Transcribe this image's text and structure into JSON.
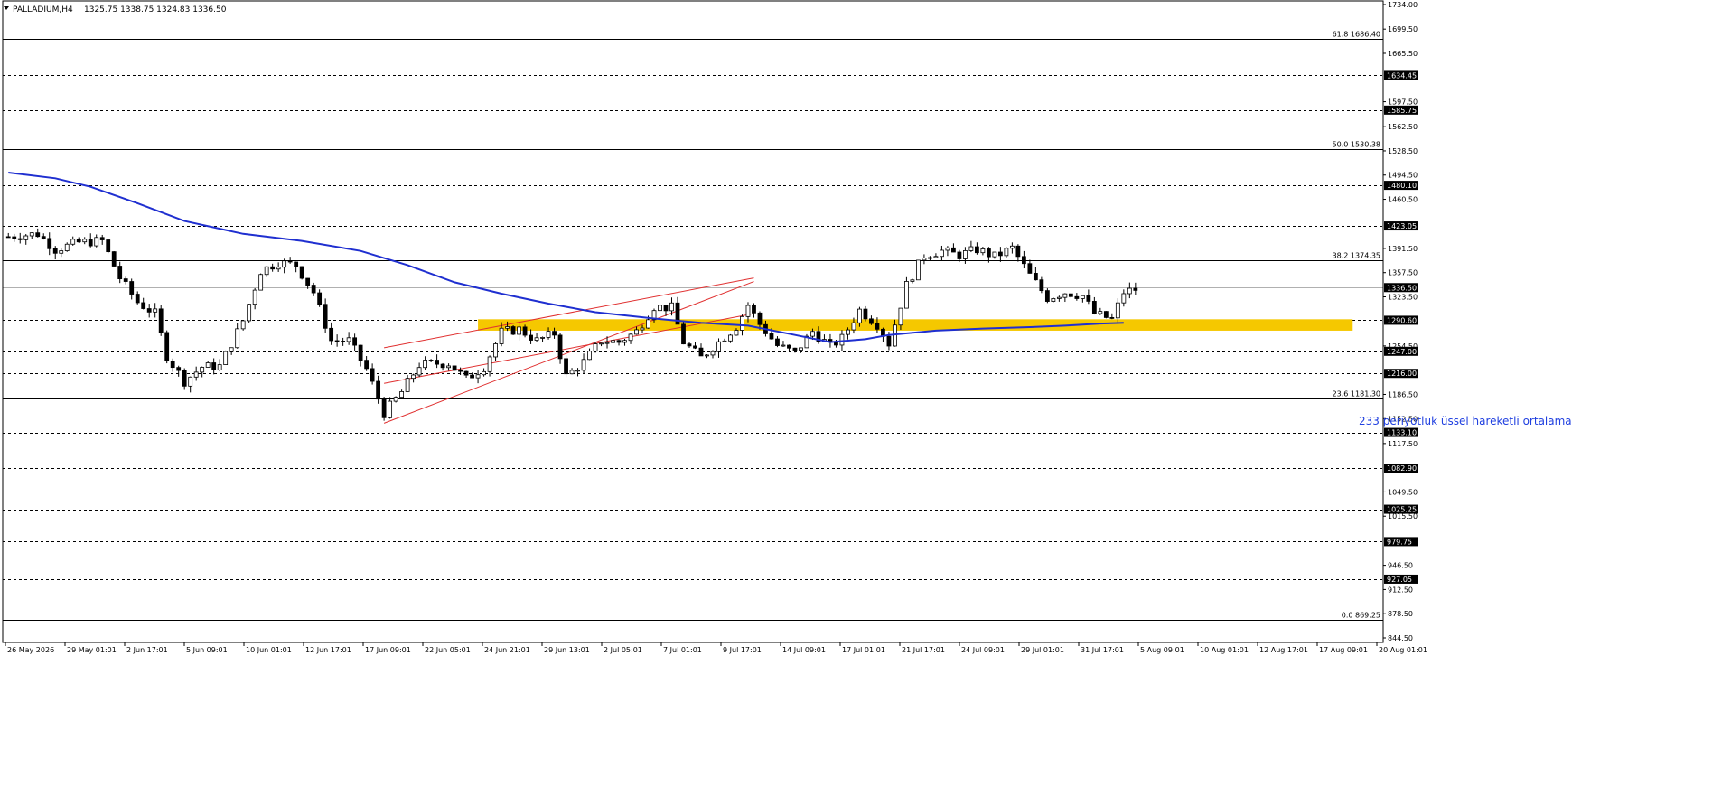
{
  "header": {
    "arrow_icon": "triangle-down-icon",
    "symbol": "PALLADIUM,H4",
    "ohlc": "1325.75 1338.75 1324.83 1336.50"
  },
  "colors": {
    "background": "#ffffff",
    "candle": "#000000",
    "ema": "#1f2fd0",
    "channel": "#e03030",
    "zone": "#f5c800",
    "ema_label": "#2040e0",
    "level_label_bg": "#000000",
    "level_label_text": "#ffffff"
  },
  "chart_data": {
    "type": "candlestick",
    "instrument": "PALLADIUM",
    "timeframe": "H4",
    "y_range": [
      844.5,
      1734.0
    ],
    "x_ticks": [
      "26 May 2026",
      "29 May 01:01",
      "2 Jun 17:01",
      "5 Jun 09:01",
      "10 Jun 01:01",
      "12 Jun 17:01",
      "17 Jun 09:01",
      "22 Jun 05:01",
      "24 Jun 21:01",
      "29 Jun 13:01",
      "2 Jul 05:01",
      "7 Jul 01:01",
      "9 Jul 17:01",
      "14 Jul 09:01",
      "17 Jul 01:01",
      "21 Jul 17:01",
      "24 Jul 09:01",
      "29 Jul 01:01",
      "31 Jul 17:01",
      "5 Aug 09:01",
      "10 Aug 01:01",
      "12 Aug 17:01",
      "17 Aug 09:01",
      "20 Aug 01:01"
    ],
    "y_ticks": [
      "1734.00",
      "1699.50",
      "1665.50",
      "1597.50",
      "1562.50",
      "1528.50",
      "1494.50",
      "1460.50",
      "1391.50",
      "1357.50",
      "1323.50",
      "1254.50",
      "1186.50",
      "1152.50",
      "1117.50",
      "1049.50",
      "1015.50",
      "946.50",
      "912.50",
      "878.50",
      "844.50"
    ],
    "horizontal_levels": [
      {
        "price": 1634.45,
        "label": "1634.45"
      },
      {
        "price": 1585.75,
        "label": "1585.75"
      },
      {
        "price": 1480.1,
        "label": "1480.10"
      },
      {
        "price": 1423.05,
        "label": "1423.05"
      },
      {
        "price": 1290.6,
        "label": "1290.60"
      },
      {
        "price": 1247.0,
        "label": "1247.00"
      },
      {
        "price": 1216.0,
        "label": "1216.00"
      },
      {
        "price": 1133.1,
        "label": "1133.10"
      },
      {
        "price": 1082.9,
        "label": "1082.90"
      },
      {
        "price": 1025.25,
        "label": "1025.25"
      },
      {
        "price": 979.75,
        "label": "979.75"
      },
      {
        "price": 927.05,
        "label": "927.05"
      }
    ],
    "current_price": {
      "price": 1336.5,
      "label": "1336.50"
    },
    "fibonacci": [
      {
        "price": 1686.4,
        "label": "61.8 1686.40"
      },
      {
        "price": 1530.38,
        "label": "50.0 1530.38"
      },
      {
        "price": 1374.35,
        "label": "38.2 1374.35"
      },
      {
        "price": 1181.3,
        "label": "23.6 1181.30"
      },
      {
        "price": 869.25,
        "label": "0.0 869.25"
      }
    ],
    "ema": {
      "label": "233 periyotluk üssel hareketli ortalama",
      "points": [
        [
          0,
          1498
        ],
        [
          8,
          1490
        ],
        [
          14,
          1478
        ],
        [
          22,
          1455
        ],
        [
          30,
          1430
        ],
        [
          40,
          1412
        ],
        [
          50,
          1402
        ],
        [
          60,
          1388
        ],
        [
          68,
          1368
        ],
        [
          76,
          1344
        ],
        [
          84,
          1328
        ],
        [
          92,
          1314
        ],
        [
          100,
          1302
        ],
        [
          110,
          1293
        ],
        [
          118,
          1287
        ],
        [
          126,
          1283
        ],
        [
          134,
          1270
        ],
        [
          140,
          1260
        ],
        [
          146,
          1264
        ],
        [
          150,
          1270
        ],
        [
          158,
          1276
        ],
        [
          166,
          1279
        ],
        [
          174,
          1281
        ],
        [
          180,
          1283
        ],
        [
          186,
          1286
        ],
        [
          190,
          1287
        ]
      ]
    },
    "zone": {
      "low": 1276,
      "high": 1292,
      "start_bar": 80,
      "end_bar": 229
    },
    "channel_lines": [
      {
        "from": [
          64,
          1146
        ],
        "to": [
          127,
          1345
        ]
      },
      {
        "from": [
          64,
          1202
        ],
        "to": [
          127,
          1300
        ]
      },
      {
        "from": [
          64,
          1252
        ],
        "to": [
          127,
          1350
        ]
      }
    ],
    "price_path": [
      [
        0,
        1408
      ],
      [
        5,
        1412
      ],
      [
        8,
        1390
      ],
      [
        12,
        1400
      ],
      [
        16,
        1402
      ],
      [
        19,
        1350
      ],
      [
        22,
        1316
      ],
      [
        25,
        1300
      ],
      [
        27,
        1240
      ],
      [
        30,
        1205
      ],
      [
        33,
        1225
      ],
      [
        36,
        1226
      ],
      [
        38,
        1258
      ],
      [
        40,
        1290
      ],
      [
        43,
        1360
      ],
      [
        46,
        1372
      ],
      [
        49,
        1368
      ],
      [
        52,
        1330
      ],
      [
        55,
        1262
      ],
      [
        58,
        1262
      ],
      [
        61,
        1222
      ],
      [
        64,
        1160
      ],
      [
        67,
        1190
      ],
      [
        70,
        1228
      ],
      [
        72,
        1230
      ],
      [
        75,
        1230
      ],
      [
        78,
        1208
      ],
      [
        81,
        1225
      ],
      [
        84,
        1274
      ],
      [
        87,
        1278
      ],
      [
        90,
        1262
      ],
      [
        93,
        1272
      ],
      [
        95,
        1212
      ],
      [
        98,
        1232
      ],
      [
        101,
        1262
      ],
      [
        104,
        1260
      ],
      [
        107,
        1275
      ],
      [
        110,
        1310
      ],
      [
        113,
        1308
      ],
      [
        115,
        1260
      ],
      [
        118,
        1238
      ],
      [
        121,
        1260
      ],
      [
        124,
        1282
      ],
      [
        126,
        1312
      ],
      [
        128,
        1285
      ],
      [
        131,
        1255
      ],
      [
        134,
        1245
      ],
      [
        137,
        1275
      ],
      [
        140,
        1254
      ],
      [
        142,
        1265
      ],
      [
        145,
        1305
      ],
      [
        148,
        1285
      ],
      [
        150,
        1258
      ],
      [
        153,
        1340
      ],
      [
        156,
        1382
      ],
      [
        159,
        1388
      ],
      [
        162,
        1382
      ],
      [
        165,
        1390
      ],
      [
        168,
        1380
      ],
      [
        171,
        1392
      ],
      [
        174,
        1354
      ],
      [
        177,
        1322
      ],
      [
        180,
        1330
      ],
      [
        183,
        1325
      ],
      [
        185,
        1300
      ],
      [
        188,
        1292
      ],
      [
        190,
        1330
      ],
      [
        192,
        1334
      ]
    ]
  }
}
